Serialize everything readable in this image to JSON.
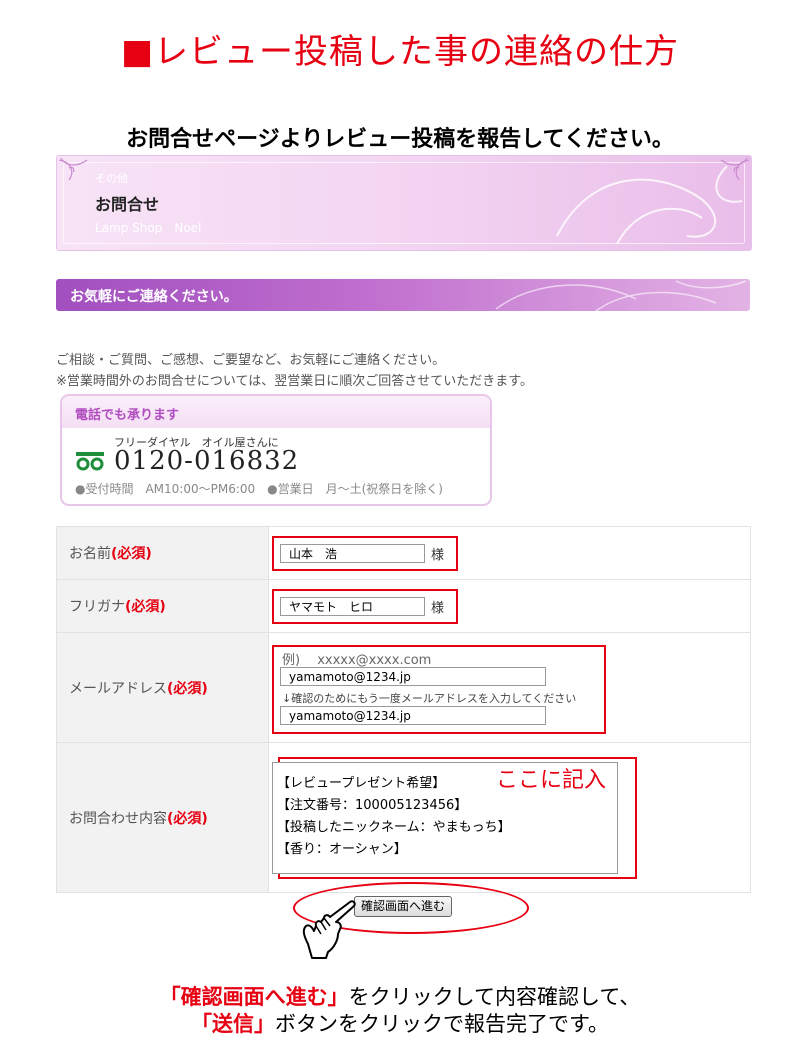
{
  "title": "■レビュー投稿した事の連絡の仕方",
  "subtitle": "お問合せページよりレビュー投稿を報告してください。",
  "banner": {
    "category": "その他",
    "heading": "お問合せ",
    "shop": "Lamp Shop　Noel"
  },
  "section_bar": "お気軽にご連絡ください。",
  "intro": {
    "line1": "ご相談・ご質問、ご感想、ご要望など、お気軽にご連絡ください。",
    "line2": "※営業時間外のお問合せについては、翌営業日に順次ご回答させていただきます。"
  },
  "tel": {
    "header": "電話でも承ります",
    "free_label": "フリーダイヤル　オイル屋さんに",
    "number": "0120-016832",
    "hours": "●受付時間　AM10:00〜PM6:00　●営業日　月〜土(祝祭日を除く)"
  },
  "form": {
    "required": "(必須)",
    "name": {
      "label": "お名前",
      "value": "山本　浩",
      "suffix": "様"
    },
    "furigana": {
      "label": "フリガナ",
      "value": "ヤマモト　ヒロ",
      "suffix": "様"
    },
    "email": {
      "label": "メールアドレス",
      "example": "例)　 xxxxx@xxxx.com",
      "value": "yamamoto@1234.jp",
      "confirm_hint": "↓確認のためにもう一度メールアドレスを入力してください",
      "confirm_value": "yamamoto@1234.jp"
    },
    "inquiry": {
      "label": "お問合わせ内容",
      "lines": [
        "【レビュープレゼント希望】",
        "【注文番号：100005123456】",
        "【投稿したニックネーム：やまもっち】",
        "【香り：オーシャン】"
      ]
    },
    "annotation": "ここに記入",
    "submit": "確認画面へ進む"
  },
  "footer": {
    "line1_em": "「確認画面へ進む」",
    "line1_rest": "をクリックして内容確認して、",
    "line2_em": "「送信」",
    "line2_rest": "ボタンをクリックで報告完了です。"
  },
  "colors": {
    "accent_red": "#e60012",
    "purple": "#b04ec0"
  },
  "icons": [
    "free-dial-icon",
    "pointing-hand-icon"
  ]
}
